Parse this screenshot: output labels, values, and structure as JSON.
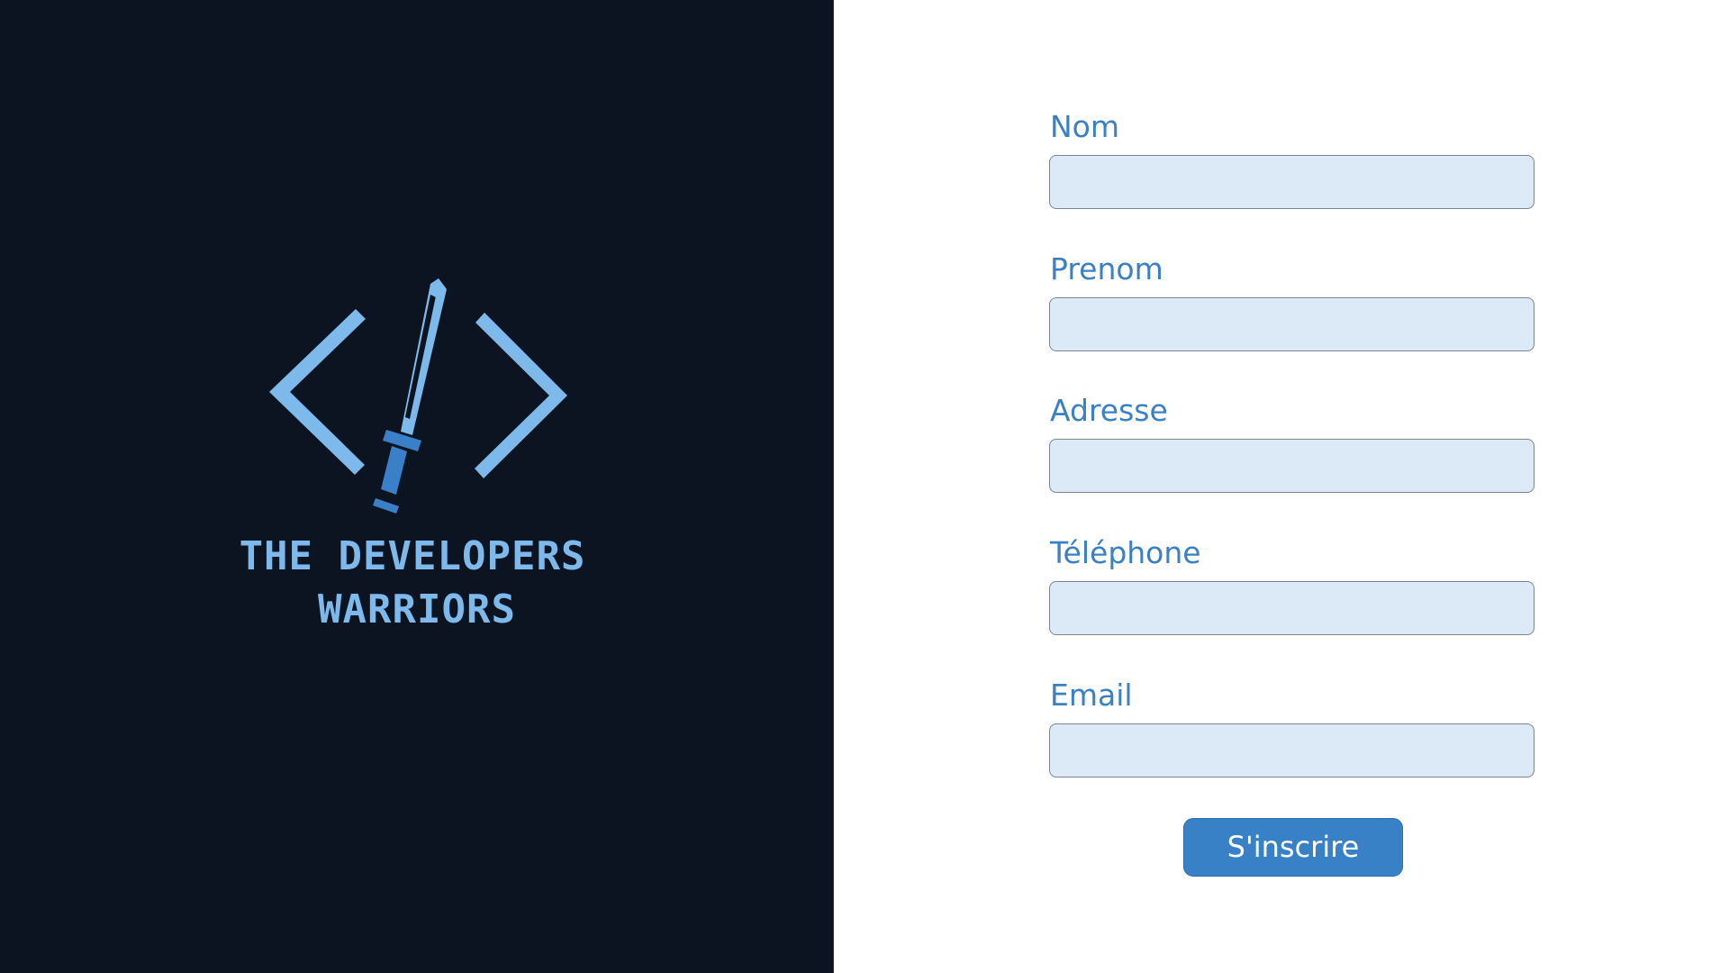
{
  "brand": {
    "line1": "THE DEVELOPERS",
    "line2": "WARRIORS",
    "logo_icon": "code-brackets-sword-logo",
    "color": "#7db9ea",
    "accent_color": "#3a80c8",
    "background": "#0b1420"
  },
  "form": {
    "fields": [
      {
        "label": "Nom",
        "value": "",
        "placeholder": ""
      },
      {
        "label": "Prenom",
        "value": "",
        "placeholder": ""
      },
      {
        "label": "Adresse",
        "value": "",
        "placeholder": ""
      },
      {
        "label": "Téléphone",
        "value": "",
        "placeholder": ""
      },
      {
        "label": "Email",
        "value": "",
        "placeholder": ""
      }
    ],
    "submit_label": "S'inscrire",
    "label_color": "#3a80c3",
    "input_background": "#dbeaf6",
    "button_color": "#3881c7"
  }
}
